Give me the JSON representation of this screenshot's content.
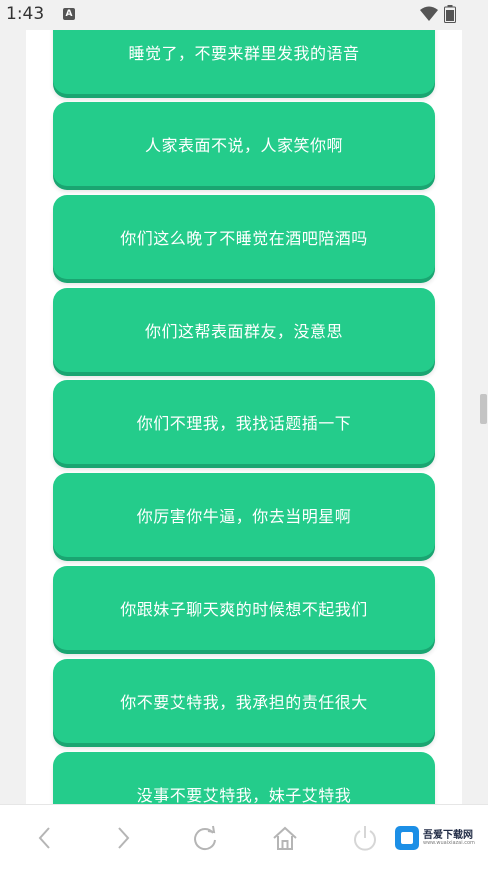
{
  "status_bar": {
    "time": "1:43",
    "app_icon_letter": "A",
    "wifi_icon": "wifi-icon",
    "battery_icon": "battery-icon"
  },
  "cards": [
    "睡觉了，不要来群里发我的语音",
    "人家表面不说，人家笑你啊",
    "你们这么晚了不睡觉在酒吧陪酒吗",
    "你们这帮表面群友，没意思",
    "你们不理我，我找话题插一下",
    "你厉害你牛逼，你去当明星啊",
    "你跟妹子聊天爽的时候想不起我们",
    "你不要艾特我，我承担的责任很大",
    "没事不要艾特我，妹子艾特我"
  ],
  "nav": {
    "back_icon": "chevron-left-icon",
    "forward_icon": "chevron-right-icon",
    "refresh_icon": "refresh-icon",
    "home_icon": "home-icon",
    "power_icon": "power-icon"
  },
  "watermark": {
    "title": "吾爱下载网",
    "subtitle": "www.wuaixiazai.com"
  },
  "colors": {
    "card": "#24cc8b",
    "card_shadow": "#1aa571",
    "background": "#f1f1f1"
  }
}
